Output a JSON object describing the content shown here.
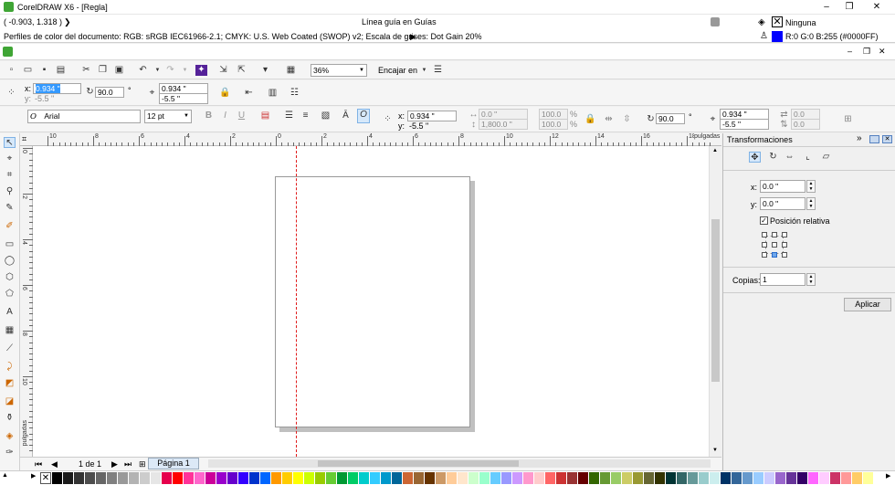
{
  "window": {
    "title": "CorelDRAW X6 - [Regla]",
    "minimize": "–",
    "restore": "❐",
    "close": "✕"
  },
  "status": {
    "coords": "( -0.903, 1.318 )",
    "arrow": "❯",
    "guide_text": "Línea guía en Guías",
    "fill_label": "Ninguna",
    "outline_label": "R:0 G:0 B:255 (#0000FF)",
    "color_profiles": "Perfiles de color del documento: RGB: sRGB IEC61966-2.1; CMYK: U.S. Web Coated (SWOP) v2; Escala de grises: Dot Gain 20%",
    "profiles_arrow": "▶",
    "outline_color": "#0000ff"
  },
  "menubar": {
    "doc_min": "–",
    "doc_restore": "❐",
    "doc_close": "✕"
  },
  "standard_toolbar": {
    "zoom": "36%",
    "snap": "Encajar en"
  },
  "property_bar": {
    "x_label": "x:",
    "x_value": "0.934 \"",
    "y_label": "y:",
    "y_value": "-5.5 \"",
    "angle": "90.0",
    "deg": "°",
    "pos_x": "0.934 \"",
    "pos_y": "-5.5 \""
  },
  "text_bar": {
    "font": "Arial",
    "size": "12 pt",
    "x_label": "x:",
    "x_value": "0.934 \"",
    "y_label": "y:",
    "y_value": "-5.5 \"",
    "w_value": "0.0 \"",
    "h_value": "1,800.0 \"",
    "scale_w": "100.0",
    "scale_h": "100.0",
    "pct": "%",
    "angle": "90.0",
    "deg": "°",
    "pos_x": "0.934 \"",
    "pos_y": "-5.5 \"",
    "skew1": "0.0",
    "skew2": "0.0"
  },
  "ruler": {
    "labels": [
      "10",
      "8",
      "6",
      "4",
      "2",
      "0",
      "2",
      "4",
      "6",
      "8",
      "10",
      "12",
      "14",
      "16",
      "18"
    ],
    "unit": "pulgadas",
    "vlabels": [
      "0",
      "2",
      "4",
      "6",
      "8",
      "10",
      "12",
      "14"
    ],
    "vunit": "pulgadas"
  },
  "page_nav": {
    "first": "⏮",
    "prev": "◀",
    "of": "1 de 1",
    "next": "▶",
    "last": "⏭",
    "tab": "Página 1"
  },
  "docker": {
    "title": "Transformaciones",
    "x_label": "x:",
    "x_value": "0.0 \"",
    "y_label": "y:",
    "y_value": "0.0 \"",
    "relative": "Posición relativa",
    "copies_label": "Copias:",
    "copies_value": "1",
    "apply": "Aplicar"
  },
  "palette": [
    "#000000",
    "#1a1a1a",
    "#333333",
    "#4d4d4d",
    "#666666",
    "#808080",
    "#999999",
    "#b3b3b3",
    "#cccccc",
    "#e6e6e6",
    "#e6004c",
    "#ff0000",
    "#ff3399",
    "#ff66cc",
    "#cc0099",
    "#9900cc",
    "#6600cc",
    "#3300ff",
    "#0033cc",
    "#0066ff",
    "#ff9900",
    "#ffcc00",
    "#ffff00",
    "#ccff00",
    "#99cc00",
    "#66cc33",
    "#009933",
    "#00cc66",
    "#00cccc",
    "#33ccff",
    "#0099cc",
    "#006699",
    "#cc6633",
    "#996633",
    "#663300",
    "#cc9966",
    "#ffcc99",
    "#ffe6cc",
    "#ccffcc",
    "#99ffcc",
    "#66ccff",
    "#9999ff",
    "#cc99ff",
    "#ff99cc",
    "#ffcccc",
    "#ff6666",
    "#cc3333",
    "#993333",
    "#660000",
    "#336600",
    "#669933",
    "#99cc66",
    "#cccc66",
    "#999933",
    "#666633",
    "#333300",
    "#003333",
    "#336666",
    "#669999",
    "#99cccc",
    "#cceeee",
    "#003366",
    "#336699",
    "#6699cc",
    "#99ccff",
    "#ccccff",
    "#9966cc",
    "#663399",
    "#330066",
    "#ff66ff",
    "#ffccff",
    "#cc3366",
    "#ff9999",
    "#ffcc66",
    "#ffff99"
  ]
}
